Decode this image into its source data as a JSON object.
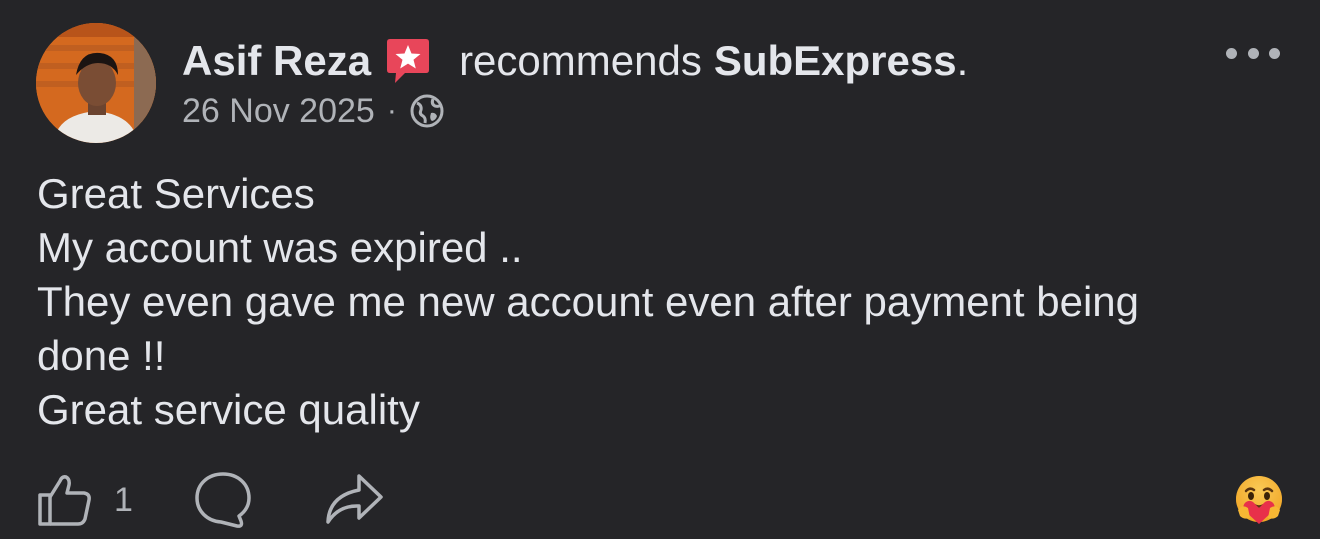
{
  "post": {
    "author": "Asif Reza",
    "recommends_text": "recommends",
    "page_name": "SubExpress",
    "period": ".",
    "date": "26 Nov 2025",
    "separator": "·",
    "privacy_icon": "globe-icon",
    "badge_icon": "recommendation-star-icon",
    "menu_icon": "more-options-icon"
  },
  "body": {
    "lines": [
      "Great Services",
      "My account was expired ..",
      "They even gave me new account even after payment being",
      "done !!",
      "Great service quality"
    ]
  },
  "actions": {
    "like_icon": "thumbs-up-icon",
    "like_count": "1",
    "comment_icon": "comment-icon",
    "share_icon": "share-icon",
    "reaction_icon": "care-emoji-icon"
  },
  "colors": {
    "background": "#252528",
    "text_primary": "#e4e6eb",
    "text_secondary": "#b0b3b8",
    "badge": "#e8465a"
  }
}
